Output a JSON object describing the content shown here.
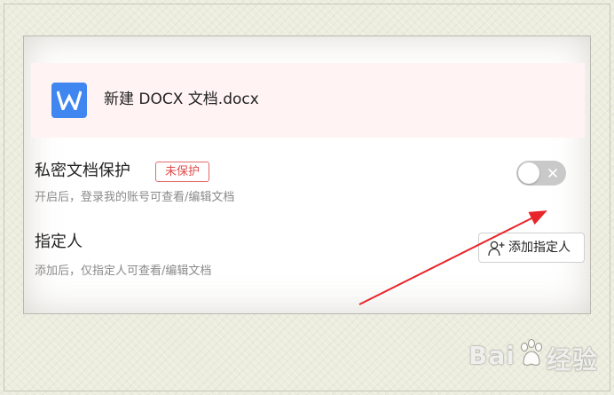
{
  "file": {
    "name": "新建 DOCX 文档.docx",
    "icon": "word-doc-icon",
    "icon_color": "#3f86f1"
  },
  "private_protection": {
    "title": "私密文档保护",
    "status_badge": "未保护",
    "description": "开启后，登录我的账号可查看/编辑文档",
    "toggle_state": "off",
    "status_color": "#e24a4a"
  },
  "designated_person": {
    "title": "指定人",
    "description": "添加后，仅指定人可查看/编辑文档",
    "add_button_label": "添加指定人",
    "add_button_icon": "add-user-icon"
  },
  "annotation": {
    "arrow_color": "#e8262a"
  },
  "watermark": {
    "brand_left": "Bai",
    "brand_right": "经验",
    "logo": "baidu-paw-icon"
  }
}
